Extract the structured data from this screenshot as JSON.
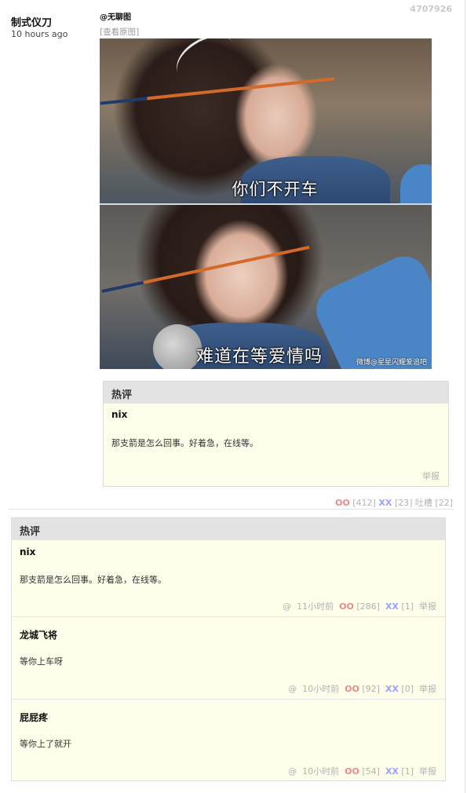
{
  "post": {
    "id": "4707926",
    "author": "制式仪刀",
    "time": "10 hours ago",
    "category": "@无聊图",
    "view_original": "[查看原图]",
    "image": {
      "caption_top": "你们不开车",
      "caption_bottom": "难道在等爱情吗",
      "watermark": "微博@星星闪耀爱追吧"
    },
    "hot_comment": {
      "header": "热评",
      "user": "nix",
      "text": "那支箭是怎么回事。好着急，在线等。",
      "report": "举报"
    },
    "stats": {
      "oo_label": "OO",
      "oo": "[412]",
      "xx_label": "XX",
      "xx": "[23]",
      "tucao": "吐槽 [22]"
    }
  },
  "hot_comments": {
    "header": "热评",
    "items": [
      {
        "user": "nix",
        "text": "那支箭是怎么回事。好着急，在线等。",
        "at": "@",
        "time": "11小时前",
        "oo_label": "OO",
        "oo": "[286]",
        "xx_label": "XX",
        "xx": "[1]",
        "report": "举报"
      },
      {
        "user": "龙城飞将",
        "text": "等你上车呀",
        "at": "@",
        "time": "10小时前",
        "oo_label": "OO",
        "oo": "[92]",
        "xx_label": "XX",
        "xx": "[0]",
        "report": "举报"
      },
      {
        "user": "屁屁疼",
        "text": "等你上了就开",
        "at": "@",
        "time": "10小时前",
        "oo_label": "OO",
        "oo": "[54]",
        "xx_label": "XX",
        "xx": "[1]",
        "report": "举报"
      }
    ]
  }
}
